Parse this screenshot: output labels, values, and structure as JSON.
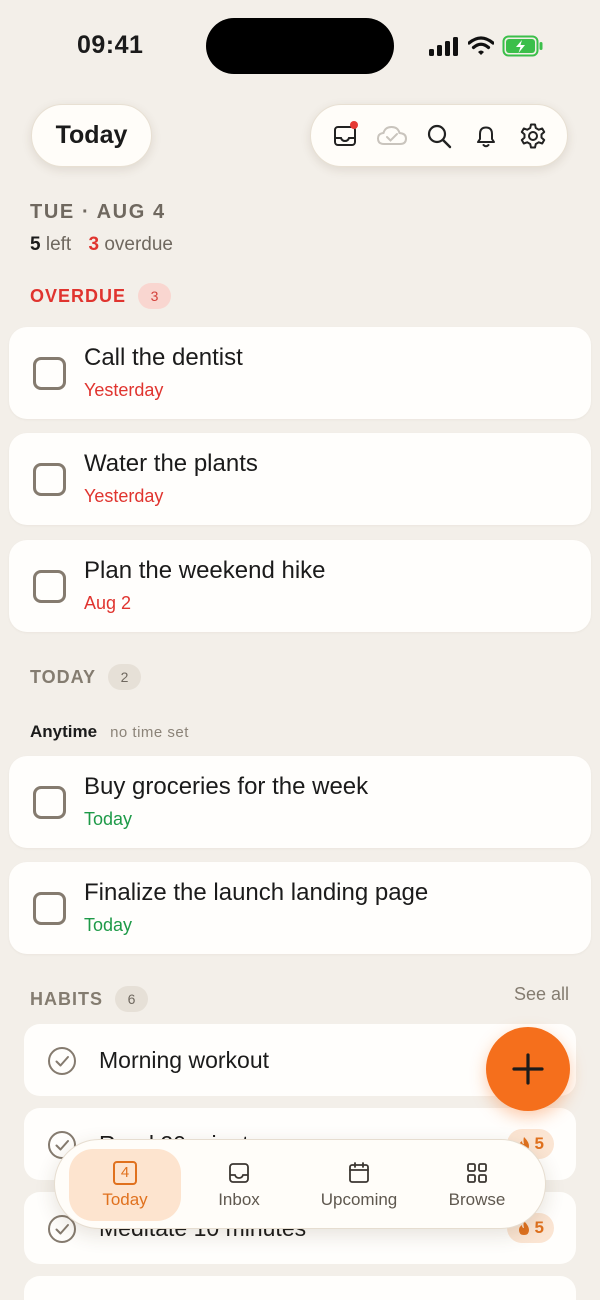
{
  "status": {
    "time": "09:41"
  },
  "header": {
    "title": "Today"
  },
  "toolbar": {
    "icons": [
      "inbox-icon",
      "cloud-check-icon",
      "search-icon",
      "bell-icon",
      "gear-icon"
    ]
  },
  "summary": {
    "date": "TUE · AUG 4",
    "left_count": "5",
    "left_label": " left",
    "overdue_count": "3",
    "overdue_label": " overdue"
  },
  "overdue": {
    "label": "OVERDUE",
    "count": "3",
    "tasks": [
      {
        "title": "Call the dentist",
        "due": "Yesterday"
      },
      {
        "title": "Water the plants",
        "due": "Yesterday"
      },
      {
        "title": "Plan the weekend hike",
        "due": "Aug 2"
      }
    ]
  },
  "today": {
    "label": "TODAY",
    "count": "2",
    "group_label": "Anytime",
    "group_sub": "no time set",
    "tasks": [
      {
        "title": "Buy groceries for the week",
        "due": "Today"
      },
      {
        "title": "Finalize the launch landing page",
        "due": "Today"
      }
    ]
  },
  "habits": {
    "label": "HABITS",
    "count": "6",
    "see_all": "See all",
    "items": [
      {
        "name": "Morning workout",
        "streak": ""
      },
      {
        "name": "Read 20 minutes",
        "streak": "5"
      },
      {
        "name": "Meditate 10 minutes",
        "streak": "5"
      }
    ]
  },
  "tabs": [
    {
      "label": "Today",
      "badge": "4",
      "icon": "calendar-today-icon"
    },
    {
      "label": "Inbox",
      "icon": "inbox-icon"
    },
    {
      "label": "Upcoming",
      "icon": "calendar-icon"
    },
    {
      "label": "Browse",
      "icon": "grid-icon"
    }
  ],
  "colors": {
    "background": "#f3efe9",
    "accent": "#f56f1c",
    "overdue": "#e0342f",
    "today": "#1e9a48"
  }
}
